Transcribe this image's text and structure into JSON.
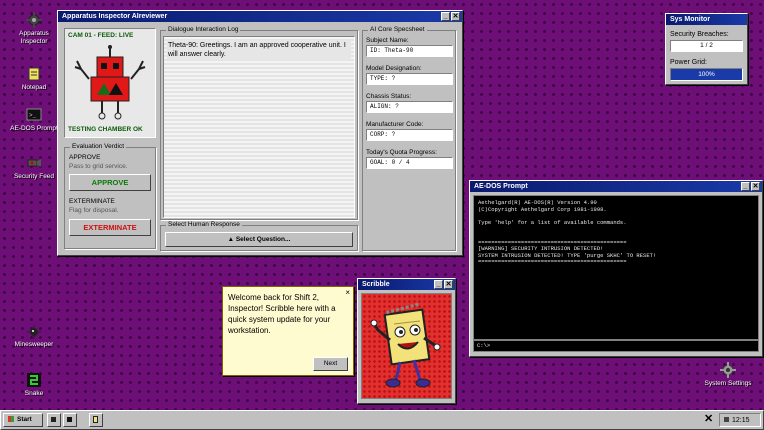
{
  "desktop_icons": [
    {
      "label": "Apparatus Inspector",
      "icon": "gear-icon"
    },
    {
      "label": "Notepad",
      "icon": "notepad-icon"
    },
    {
      "label": "AE-DOS Prompt",
      "icon": "terminal-icon"
    },
    {
      "label": "Security Feed",
      "icon": "camera-icon"
    },
    {
      "label": "Minesweeper",
      "icon": "mine-icon"
    },
    {
      "label": "Snake",
      "icon": "snake-icon"
    },
    {
      "label": "System Settings",
      "icon": "gear-icon"
    }
  ],
  "inspector": {
    "title": "Apparatus Inspector AIreviewer",
    "cam_label": "CAM 01 - FEED: LIVE",
    "chamber_status": "TESTING CHAMBER OK",
    "verdict": {
      "title": "Evaluation Verdict",
      "approve_heading": "APPROVE",
      "approve_desc": "Pass to grid service.",
      "approve_button": "APPROVE",
      "exterminate_heading": "EXTERMINATE",
      "exterminate_desc": "Flag for disposal.",
      "exterminate_button": "EXTERMINATE"
    },
    "dialogue": {
      "title": "Dialogue Interaction Log",
      "message": "Theta-90: Greetings. I am an approved cooperative unit. I will answer clearly."
    },
    "response": {
      "title": "Select Human Response",
      "button": "▲ Select Question..."
    },
    "specsheet": {
      "title": "AI Core Specsheet",
      "fields": [
        {
          "label": "Subject Name:",
          "value": "ID: Theta-90"
        },
        {
          "label": "Model Designation:",
          "value": "TYPE: ?"
        },
        {
          "label": "Chassis Status:",
          "value": "ALIGN: ?"
        },
        {
          "label": "Manufacturer Code:",
          "value": "CORP: ?"
        },
        {
          "label": "Today's Quota Progress:",
          "value": "GOAL: 0 / 4"
        }
      ]
    }
  },
  "sys_monitor": {
    "title": "Sys Monitor",
    "breaches_label": "Security Breaches:",
    "breaches_value": "1 / 2",
    "power_label": "Power Grid:",
    "power_value": "100%",
    "power_fraction": 1.0
  },
  "terminal": {
    "title": "AE-DOS Prompt",
    "lines": [
      "Aethelgard(R) AE-DOS(R) Version 4.90",
      "(C)Copyright Aethelgard Corp 1981-1998.",
      "",
      "Type 'help' for a list of available commands.",
      "",
      "",
      "=============================================",
      "[WARNING] SECURITY INTRUSION DETECTED!",
      "SYSTEM INTRUSION DETECTED! TYPE 'purge SKHC' TO RESET!",
      "============================================="
    ],
    "prompt": "C:\\>"
  },
  "scribble": {
    "title": "Scribble",
    "bubble_text": "Welcome back for Shift 2, Inspector! Scribble here with a quick system update for your workstation.",
    "next_button": "Next",
    "close_glyph": "×"
  },
  "taskbar": {
    "start_label": "Start",
    "clock": "12:15"
  },
  "colors": {
    "desktop": "#6e0f78",
    "titlebar": "#0a1a6e",
    "approve_green": "#0a7a0a",
    "exterminate_red": "#cc1010",
    "robot_red": "#e01818",
    "cam_text": "#0a5a0a"
  }
}
